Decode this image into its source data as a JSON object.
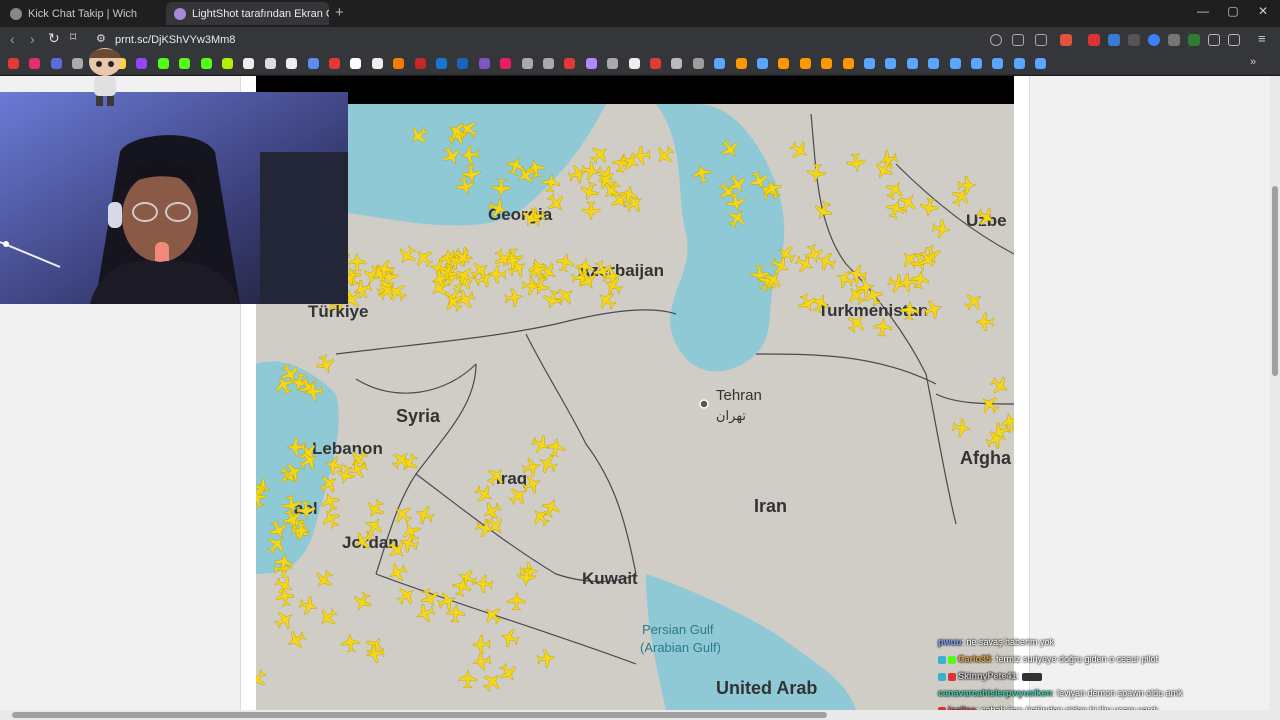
{
  "tabs": [
    {
      "title": "Kick Chat Takip | Wich",
      "active": false
    },
    {
      "title": "LightShot tarafından Ekran Görü",
      "active": true
    }
  ],
  "address_bar": {
    "url": "prnt.sc/DjKShVYw3Mm8"
  },
  "map_labels": {
    "georgia": "Georgia",
    "azerbaijan": "Azerbaijan",
    "turkmenistan": "Turkmenistan",
    "uzbekistan": "Uzbe",
    "turkiye": "Türkiye",
    "syria": "Syria",
    "lebanon": "Lebanon",
    "iraq": "Iraq",
    "tehran": "Tehran",
    "tehran_local": "تهران",
    "afghanistan": "Afgha",
    "iran": "Iran",
    "israel": "ael",
    "jordan": "Jordan",
    "kuwait": "Kuwait",
    "gulf_1": "Persian Gulf",
    "gulf_2": "(Arabian Gulf)",
    "uae": "United Arab"
  },
  "chat": {
    "messages": [
      {
        "user": "pwuu",
        "user_color": "#7c9cff",
        "text": ": ne savaş haberim yok"
      },
      {
        "user": "Carlo35",
        "user_color": "#e8a23a",
        "text": ": fermiz suriyeye doğru giden o ceeur pilot"
      },
      {
        "user": "SkinnyPete41",
        "user_color": "#c9c9c9",
        "text": ":"
      },
      {
        "user": "canavarcahislerpwyusiken",
        "user_color": "#3fd0b0",
        "text": ": leviyan demon spawn oldu amk"
      },
      {
        "user": "issline",
        "user_color": "#e05050",
        "text": ": sabah iran üstünden giden bi thy uçapı vardı"
      }
    ]
  },
  "colors": {
    "land": "#cfcdc6",
    "water": "#8fc9d6",
    "plane": "#f4d61a",
    "border": "#4a4a4a"
  }
}
